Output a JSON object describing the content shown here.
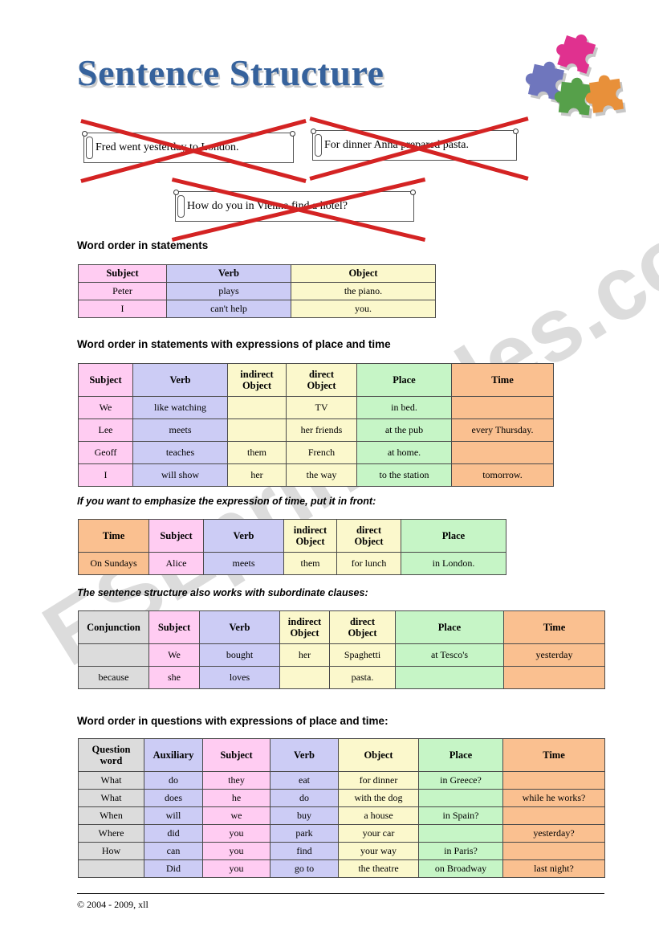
{
  "title": "Sentence Structure",
  "watermark": "ESLprintables.com",
  "wrong_examples": [
    {
      "text": "Fred went yesterday to London."
    },
    {
      "text": "For dinner Anna prepared pasta."
    },
    {
      "text": "How do you in Vienna find a hotel?"
    }
  ],
  "sections": {
    "statements_heading": "Word order in statements",
    "place_time_heading": "Word order in statements with expressions of place and time",
    "emphasis_caption": "If you want to emphasize the expression of time, put it in front:",
    "subordinate_caption": "The sentence structure also works with subordinate clauses:",
    "questions_heading": "Word order in questions with expressions of place and time:"
  },
  "colors": {
    "subject": "#ffccf2",
    "verb": "#ccccf5",
    "object": "#fbf8cc",
    "place": "#c6f5c6",
    "time": "#fac090",
    "conjunction": "#dcdcdc",
    "title": "#36629c",
    "cross": "#d42323",
    "watermark": "#cfcfcf"
  },
  "puzzle_colors": [
    "#e0318f",
    "#6f76bd",
    "#56a04a",
    "#e8903a"
  ],
  "table_statements": {
    "headers": [
      "Subject",
      "Verb",
      "Object"
    ],
    "rows": [
      [
        "Peter",
        "plays",
        "the piano."
      ],
      [
        "I",
        "can't help",
        "you."
      ]
    ]
  },
  "table_place_time": {
    "headers": [
      "Subject",
      "Verb",
      "indirect Object",
      "direct Object",
      "Place",
      "Time"
    ],
    "rows": [
      [
        "We",
        "like watching",
        "",
        "TV",
        "in bed.",
        ""
      ],
      [
        "Lee",
        "meets",
        "",
        "her friends",
        "at the pub",
        "every Thursday."
      ],
      [
        "Geoff",
        "teaches",
        "them",
        "French",
        "at home.",
        ""
      ],
      [
        "I",
        "will show",
        "her",
        "the way",
        "to the station",
        "tomorrow."
      ]
    ]
  },
  "table_time_front": {
    "headers": [
      "Time",
      "Subject",
      "Verb",
      "indirect Object",
      "direct Object",
      "Place"
    ],
    "rows": [
      [
        "On Sundays",
        "Alice",
        "meets",
        "them",
        "for lunch",
        "in London."
      ]
    ]
  },
  "table_subordinate": {
    "headers": [
      "Conjunction",
      "Subject",
      "Verb",
      "indirect Object",
      "direct Object",
      "Place",
      "Time"
    ],
    "rows": [
      [
        "",
        "We",
        "bought",
        "her",
        "Spaghetti",
        "at Tesco's",
        "yesterday"
      ],
      [
        "because",
        "she",
        "loves",
        "",
        "pasta.",
        "",
        ""
      ]
    ]
  },
  "table_questions": {
    "headers": [
      "Question word",
      "Auxiliary",
      "Subject",
      "Verb",
      "Object",
      "Place",
      "Time"
    ],
    "rows": [
      [
        "What",
        "do",
        "they",
        "eat",
        "for dinner",
        "in Greece?",
        ""
      ],
      [
        "What",
        "does",
        "he",
        "do",
        "with the dog",
        "",
        "while he works?"
      ],
      [
        "When",
        "will",
        "we",
        "buy",
        "a house",
        "in Spain?",
        ""
      ],
      [
        "Where",
        "did",
        "you",
        "park",
        "your car",
        "",
        "yesterday?"
      ],
      [
        "How",
        "can",
        "you",
        "find",
        "your way",
        "in Paris?",
        ""
      ],
      [
        "",
        "Did",
        "you",
        "go to",
        "the theatre",
        "on Broadway",
        "last night?"
      ]
    ]
  },
  "footer": "© 2004 - 2009, xll"
}
